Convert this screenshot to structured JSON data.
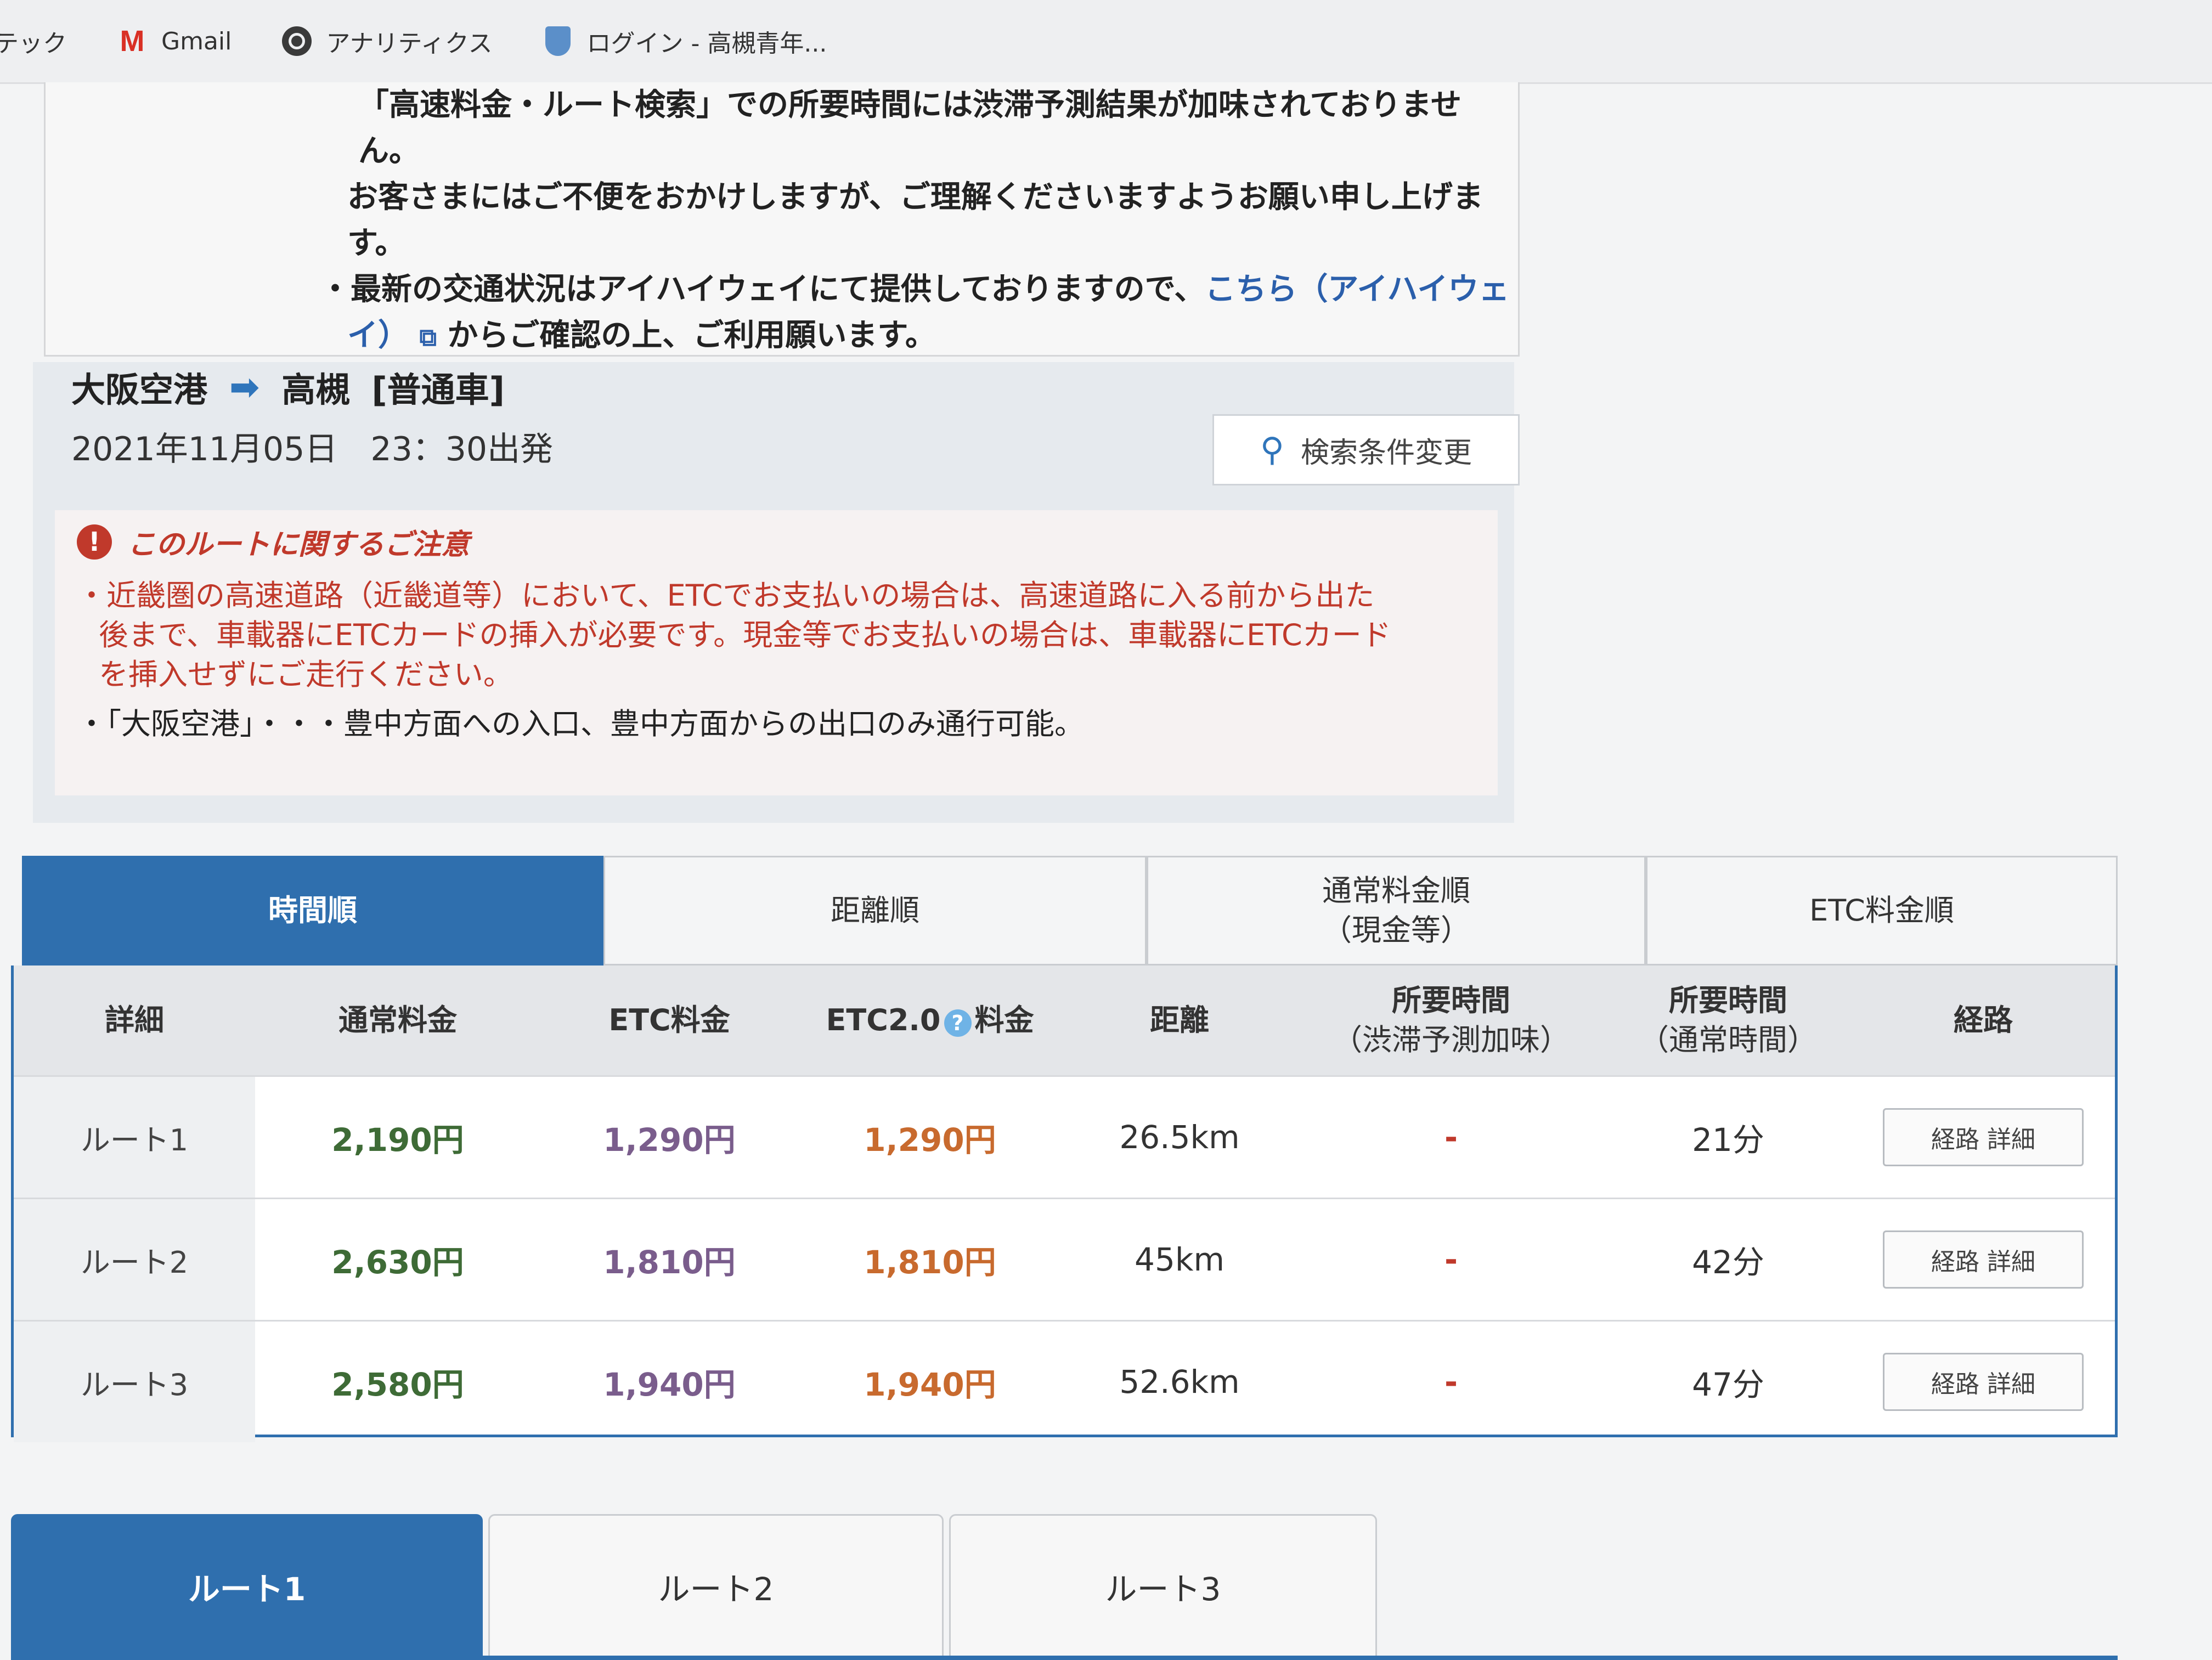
{
  "bookmarks": [
    {
      "label": "テック",
      "icon": "none"
    },
    {
      "label": "Gmail",
      "icon": "gmail-icon"
    },
    {
      "label": "アナリティクス",
      "icon": "globe-icon"
    },
    {
      "label": "ログイン - 高槻青年...",
      "icon": "shield-icon"
    }
  ],
  "notice": {
    "line1": "「高速料金・ルート検索」での所要時間には渋滞予測結果が加味されておりません。",
    "line2": "お客さまにはご不便をおかけしますが、ご理解くださいますようお願い申し上げます。",
    "line3_prefix": "・最新の交通状況はアイハイウェイにて提供しておりますので、",
    "line3_link": "こちら（アイハイウェ",
    "line4_link": "イ）",
    "line4_suffix": "からご確認の上、ご利用願います。"
  },
  "route": {
    "from": "大阪空港",
    "to": "高槻",
    "car_type": "[普通車]",
    "datetime": "2021年11月05日　23：30出発",
    "search_button": "検索条件変更"
  },
  "caution": {
    "title": "このルートに関するご注意",
    "line1": "・近畿圏の高速道路（近畿道等）において、ETCでお支払いの場合は、高速道路に入る前から出た",
    "line2": "後まで、車載器にETCカードの挿入が必要です。現金等でお支払いの場合は、車載器にETCカード",
    "line3": "を挿入せずにご走行ください。",
    "line4": "・「大阪空港」・・・豊中方面への入口、豊中方面からの出口のみ通行可能。"
  },
  "sort_tabs": [
    {
      "label": "時間順",
      "active": true
    },
    {
      "label": "距離順",
      "active": false
    },
    {
      "label": "通常料金順",
      "sub": "（現金等）",
      "active": false
    },
    {
      "label": "ETC料金順",
      "active": false
    }
  ],
  "table": {
    "headers": {
      "detail": "詳細",
      "normal": "通常料金",
      "etc": "ETC料金",
      "etc2_pre": "ETC2.0",
      "etc2_post": "料金",
      "distance": "距離",
      "time_traffic": "所要時間",
      "time_traffic_sub": "（渋滞予測加味）",
      "time_normal": "所要時間",
      "time_normal_sub": "（通常時間）",
      "route": "経路"
    },
    "rows": [
      {
        "name": "ルート1",
        "normal": "2,190円",
        "etc": "1,290円",
        "etc2": "1,290円",
        "distance": "26.5km",
        "time_traffic": "-",
        "time_normal": "21分",
        "button": "経路 詳細"
      },
      {
        "name": "ルート2",
        "normal": "2,630円",
        "etc": "1,810円",
        "etc2": "1,810円",
        "distance": "45km",
        "time_traffic": "-",
        "time_normal": "42分",
        "button": "経路 詳細"
      },
      {
        "name": "ルート3",
        "normal": "2,580円",
        "etc": "1,940円",
        "etc2": "1,940円",
        "distance": "52.6km",
        "time_traffic": "-",
        "time_normal": "47分",
        "button": "経路 詳細"
      }
    ]
  },
  "route_tabs": [
    {
      "label": "ルート1",
      "active": true
    },
    {
      "label": "ルート2",
      "active": false
    },
    {
      "label": "ルート3",
      "active": false
    }
  ],
  "colors": {
    "accent": "#2f6fae",
    "caution_red": "#c0392b",
    "normal_price": "#3e6b36",
    "etc_price": "#7a5d8c",
    "etc2_price": "#c86a2e"
  }
}
